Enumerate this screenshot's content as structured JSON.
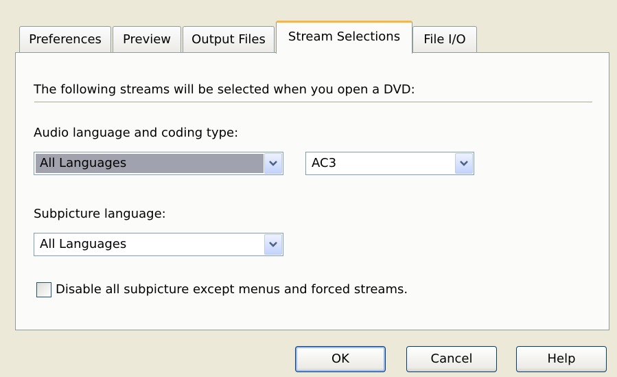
{
  "tabs": [
    {
      "label": "Preferences",
      "active": false
    },
    {
      "label": "Preview",
      "active": false
    },
    {
      "label": "Output Files",
      "active": false
    },
    {
      "label": "Stream Selections",
      "active": true
    },
    {
      "label": "File I/O",
      "active": false
    }
  ],
  "panel": {
    "intro": "The following streams will be selected when you open a DVD:",
    "audio_label": "Audio language and coding type:",
    "audio_language": {
      "value": "All Languages",
      "icon": "chevron-down-icon"
    },
    "audio_coding": {
      "value": "AC3",
      "icon": "chevron-down-icon"
    },
    "subpicture_label": "Subpicture language:",
    "subpicture_language": {
      "value": "All Languages",
      "icon": "chevron-down-icon"
    },
    "disable_checkbox": {
      "label": "Disable all subpicture except menus and forced streams.",
      "checked": false
    }
  },
  "buttons": {
    "ok": "OK",
    "cancel": "Cancel",
    "help": "Help"
  },
  "colors": {
    "background": "#ece9d8",
    "panel": "#fbfbf9",
    "active_tab_accent": "#f7b640",
    "selection_highlight": "#a0a2ad",
    "combo_border": "#7f9db9"
  }
}
